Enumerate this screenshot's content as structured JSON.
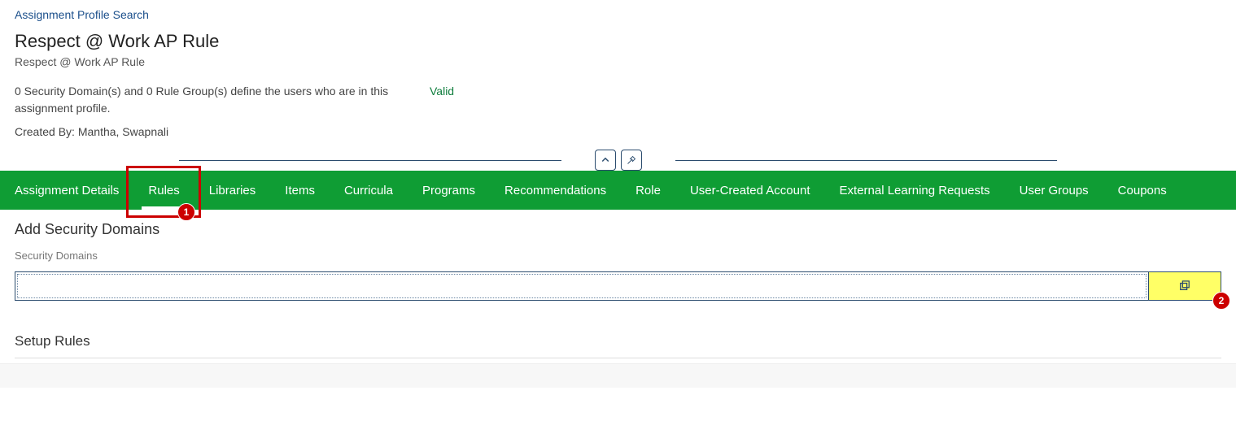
{
  "breadcrumb": "Assignment Profile Search",
  "title": "Respect @ Work AP Rule",
  "subtitle": "Respect @ Work AP Rule",
  "summary": "0 Security Domain(s) and 0 Rule Group(s) define the users who are in this assignment profile.",
  "created_by_label": "Created By:",
  "created_by_value": "Mantha, Swapnali",
  "status": "Valid",
  "tabs": [
    {
      "label": "Assignment Details",
      "active": false
    },
    {
      "label": "Rules",
      "active": true
    },
    {
      "label": "Libraries",
      "active": false
    },
    {
      "label": "Items",
      "active": false
    },
    {
      "label": "Curricula",
      "active": false
    },
    {
      "label": "Programs",
      "active": false
    },
    {
      "label": "Recommendations",
      "active": false
    },
    {
      "label": "Role",
      "active": false
    },
    {
      "label": "User-Created Account",
      "active": false
    },
    {
      "label": "External Learning Requests",
      "active": false
    },
    {
      "label": "User Groups",
      "active": false
    },
    {
      "label": "Coupons",
      "active": false
    }
  ],
  "section_add_domains": "Add Security Domains",
  "field_label": "Security Domains",
  "input_value": "",
  "section_setup_rules": "Setup Rules",
  "annotations": {
    "badge1": "1",
    "badge2": "2"
  }
}
